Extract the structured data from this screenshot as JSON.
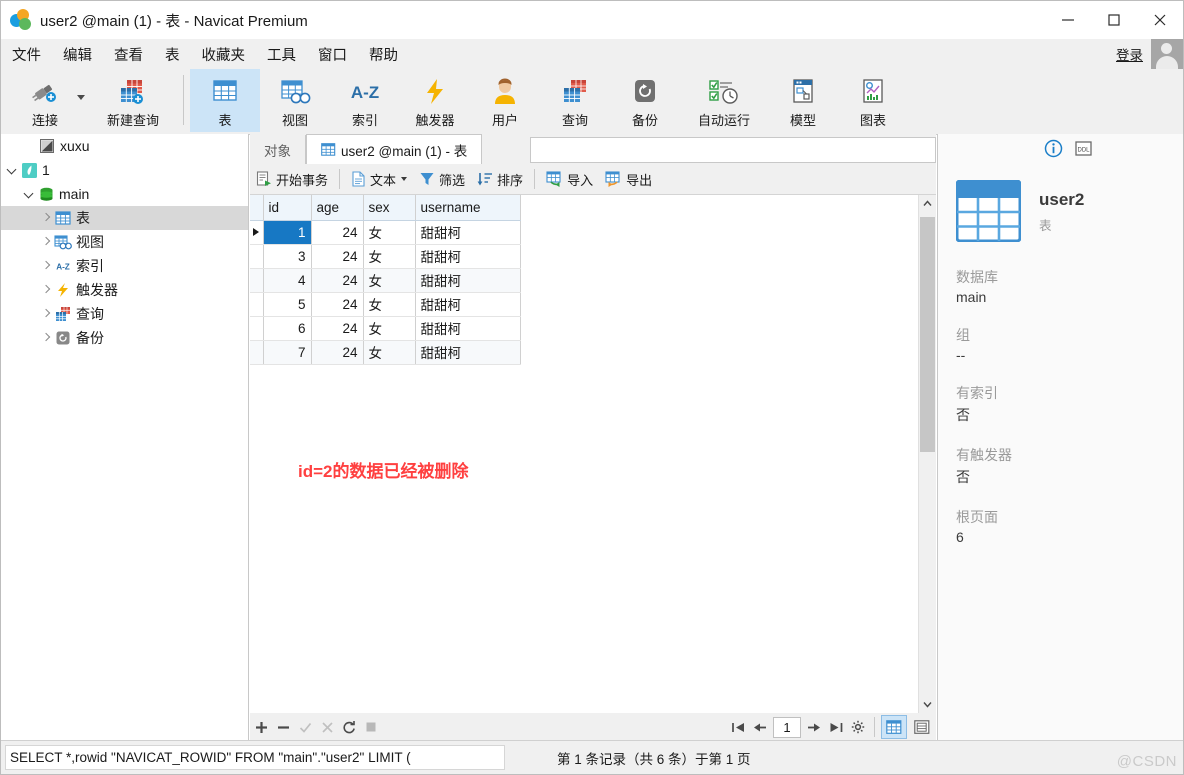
{
  "window": {
    "title": "user2 @main (1) - 表 - Navicat Premium",
    "minimize": "—",
    "maximize": "▢",
    "close": "✕"
  },
  "menubar": {
    "items": [
      {
        "label": "文件"
      },
      {
        "label": "编辑"
      },
      {
        "label": "查看"
      },
      {
        "label": "表"
      },
      {
        "label": "收藏夹"
      },
      {
        "label": "工具"
      },
      {
        "label": "窗口"
      },
      {
        "label": "帮助"
      }
    ],
    "login_label": "登录"
  },
  "toolbar": {
    "items": [
      {
        "label": "连接",
        "icon": "connection-icon"
      },
      {
        "label": "新建查询",
        "icon": "new-query-icon"
      },
      {
        "label": "表",
        "icon": "table-icon",
        "selected": true
      },
      {
        "label": "视图",
        "icon": "view-icon"
      },
      {
        "label": "索引",
        "icon": "index-icon"
      },
      {
        "label": "触发器",
        "icon": "trigger-icon"
      },
      {
        "label": "用户",
        "icon": "user-icon"
      },
      {
        "label": "查询",
        "icon": "query-icon"
      },
      {
        "label": "备份",
        "icon": "backup-icon"
      },
      {
        "label": "自动运行",
        "icon": "automation-icon"
      },
      {
        "label": "模型",
        "icon": "model-icon"
      },
      {
        "label": "图表",
        "icon": "chart-icon"
      }
    ]
  },
  "sidebar": {
    "items": [
      {
        "label": "xuxu",
        "icon": "navicat-file-icon",
        "indent": 1,
        "expander": "none",
        "selected": false
      },
      {
        "label": "1",
        "icon": "sqlite-connection-icon",
        "indent": 0,
        "expander": "down",
        "selected": false
      },
      {
        "label": "main",
        "icon": "database-icon",
        "indent": 1,
        "expander": "down",
        "selected": false
      },
      {
        "label": "表",
        "icon": "table-icon",
        "indent": 2,
        "expander": "right",
        "selected": true
      },
      {
        "label": "视图",
        "icon": "view-icon",
        "indent": 2,
        "expander": "right",
        "selected": false
      },
      {
        "label": "索引",
        "icon": "index-icon",
        "indent": 2,
        "expander": "right",
        "selected": false
      },
      {
        "label": "触发器",
        "icon": "trigger-icon",
        "indent": 2,
        "expander": "right",
        "selected": false
      },
      {
        "label": "查询",
        "icon": "query-icon",
        "indent": 2,
        "expander": "right",
        "selected": false
      },
      {
        "label": "备份",
        "icon": "backup-icon",
        "indent": 2,
        "expander": "right",
        "selected": false
      }
    ]
  },
  "tabs": {
    "object_tab": "对象",
    "active_tab": "user2 @main (1) - 表"
  },
  "grid_toolbar": {
    "begin_transaction": "开始事务",
    "text": "文本",
    "filter": "筛选",
    "sort": "排序",
    "import": "导入",
    "export": "导出"
  },
  "grid": {
    "columns": [
      "id",
      "age",
      "sex",
      "username"
    ],
    "rows": [
      {
        "id": "1",
        "age": "24",
        "sex": "女",
        "username": "甜甜柯",
        "selected": true
      },
      {
        "id": "3",
        "age": "24",
        "sex": "女",
        "username": "甜甜柯",
        "selected": false
      },
      {
        "id": "4",
        "age": "24",
        "sex": "女",
        "username": "甜甜柯",
        "selected": false
      },
      {
        "id": "5",
        "age": "24",
        "sex": "女",
        "username": "甜甜柯",
        "selected": false
      },
      {
        "id": "6",
        "age": "24",
        "sex": "女",
        "username": "甜甜柯",
        "selected": false
      },
      {
        "id": "7",
        "age": "24",
        "sex": "女",
        "username": "甜甜柯",
        "selected": false
      }
    ],
    "annotation": "id=2的数据已经被删除"
  },
  "nav": {
    "add": "＋",
    "remove": "－",
    "confirm": "✓",
    "cancel": "✕",
    "refresh": "⟳",
    "stop": "■",
    "first": "⇤",
    "prev": "←",
    "page": "1",
    "next": "→",
    "last": "⇥",
    "settings": "⚙"
  },
  "info_panel": {
    "title": "user2",
    "subtitle": "表",
    "fields": [
      {
        "key": "数据库",
        "value": "main"
      },
      {
        "key": "组",
        "value": "--"
      },
      {
        "key": "有索引",
        "value": "否"
      },
      {
        "key": "有触发器",
        "value": "否"
      },
      {
        "key": "根页面",
        "value": "6"
      }
    ]
  },
  "status": {
    "sql": "SELECT *,rowid \"NAVICAT_ROWID\" FROM \"main\".\"user2\" LIMIT (",
    "records": "第 1 条记录（共 6 条）于第 1 页",
    "watermark": "@CSDN"
  }
}
